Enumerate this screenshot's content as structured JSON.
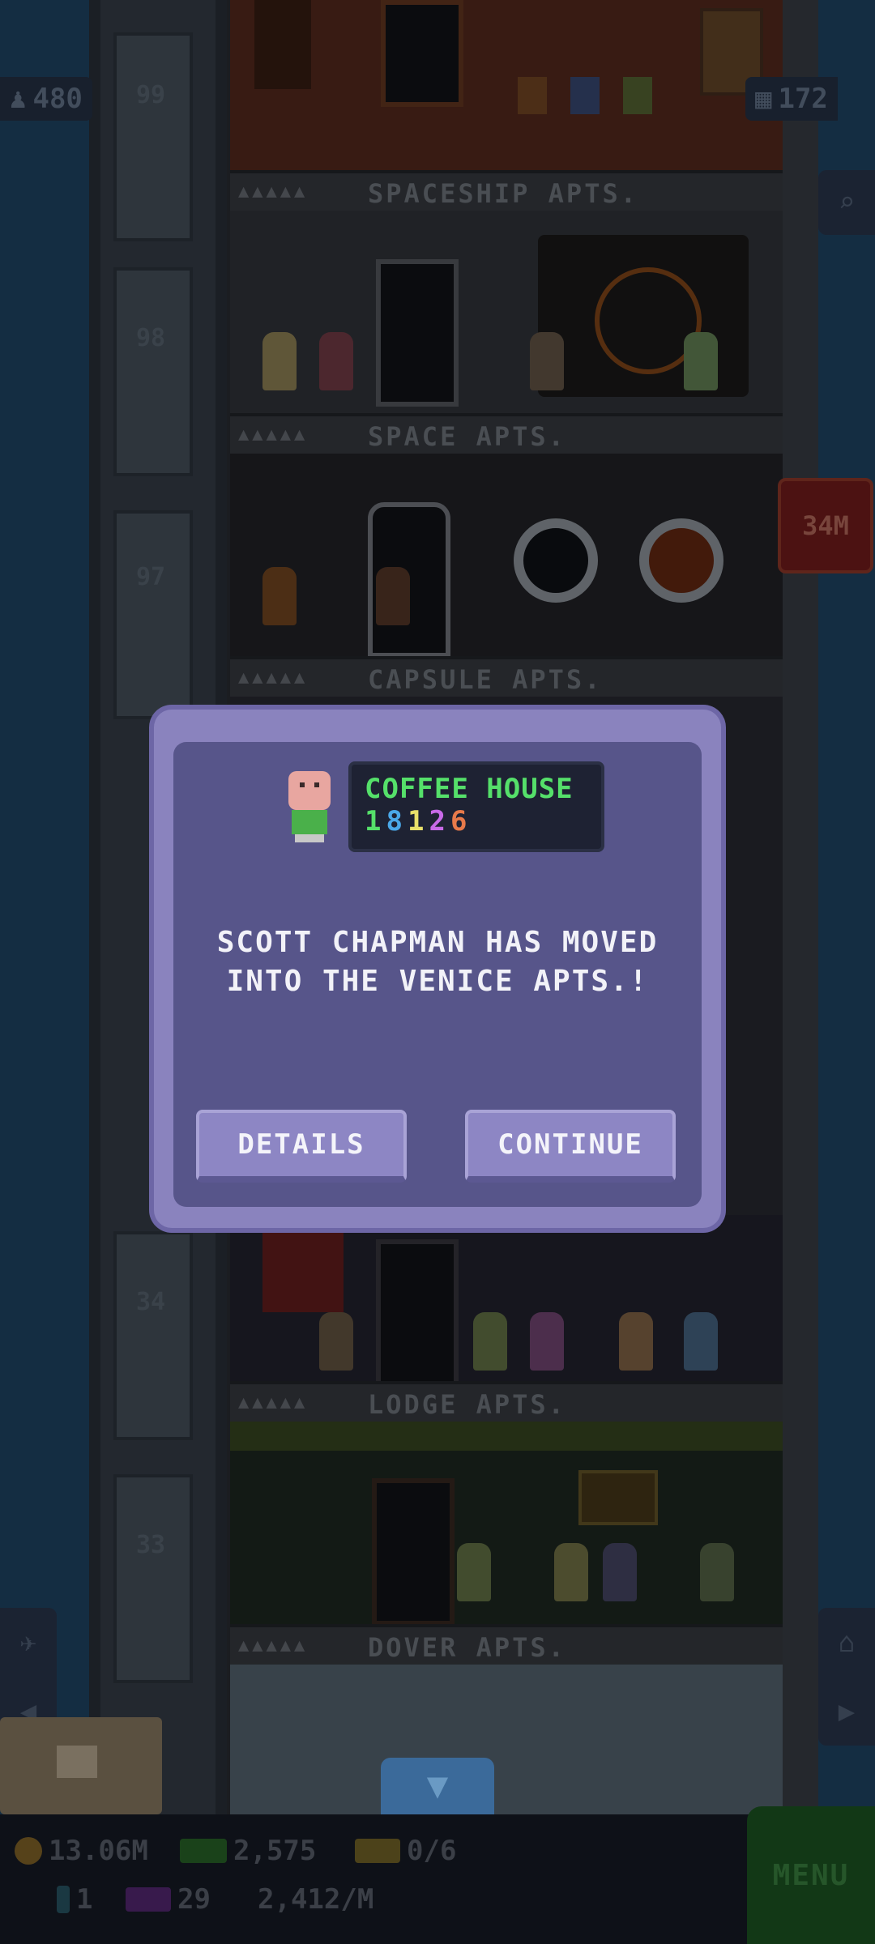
{
  "counters": {
    "population": "480",
    "floors": "172",
    "coin_badge": "34M"
  },
  "floor_numbers": [
    "99",
    "98",
    "97",
    "34",
    "33"
  ],
  "floors": [
    {
      "name": "SPACESHIP APTS."
    },
    {
      "name": "SPACE APTS."
    },
    {
      "name": "CAPSULE APTS."
    },
    {
      "name": "LODGE APTS."
    },
    {
      "name": "DOVER APTS."
    }
  ],
  "modal": {
    "ticker_title": "COFFEE HOUSE",
    "ticker_digits": [
      "1",
      "8",
      "1",
      "2",
      "6"
    ],
    "message_line1": "SCOTT CHAPMAN HAS MOVED",
    "message_line2": "INTO THE VENICE APTS.!",
    "details_label": "DETAILS",
    "continue_label": "CONTINUE"
  },
  "hud": {
    "coins": "13.06M",
    "bux": "2,575",
    "tickets": "0/6",
    "elevator_count": "1",
    "level": "29",
    "income": "2,412/M",
    "menu_label": "MENU"
  },
  "colors": {
    "modal_border": "#8a83be",
    "modal_body": "#57558a",
    "ticker_green": "#55e06a",
    "button_face": "#8d86c4"
  }
}
